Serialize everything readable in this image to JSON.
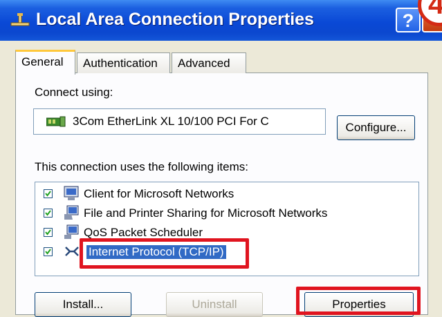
{
  "window": {
    "title": "Local Area Connection Properties",
    "help_label": "?",
    "step_number": "4"
  },
  "tabs": [
    {
      "label": "General",
      "active": true
    },
    {
      "label": "Authentication",
      "active": false
    },
    {
      "label": "Advanced",
      "active": false
    }
  ],
  "connect_using": {
    "label": "Connect using:",
    "adapter": "3Com EtherLink XL 10/100 PCI For C",
    "configure_label": "Configure..."
  },
  "items_section": {
    "label": "This connection uses the following items:",
    "items": [
      {
        "label": "Client for Microsoft Networks",
        "checked": true,
        "icon": "network-client-icon"
      },
      {
        "label": "File and Printer Sharing for Microsoft Networks",
        "checked": true,
        "icon": "file-printer-sharing-icon"
      },
      {
        "label": "QoS Packet Scheduler",
        "checked": true,
        "icon": "qos-scheduler-icon"
      },
      {
        "label": "Internet Protocol (TCP/IP)",
        "checked": true,
        "selected": true,
        "icon": "protocol-icon"
      }
    ]
  },
  "buttons": {
    "install": "Install...",
    "uninstall": "Uninstall",
    "properties": "Properties"
  },
  "colors": {
    "titlebar": "#0a49d6",
    "selection": "#316ac5",
    "highlight": "#e0141f"
  }
}
